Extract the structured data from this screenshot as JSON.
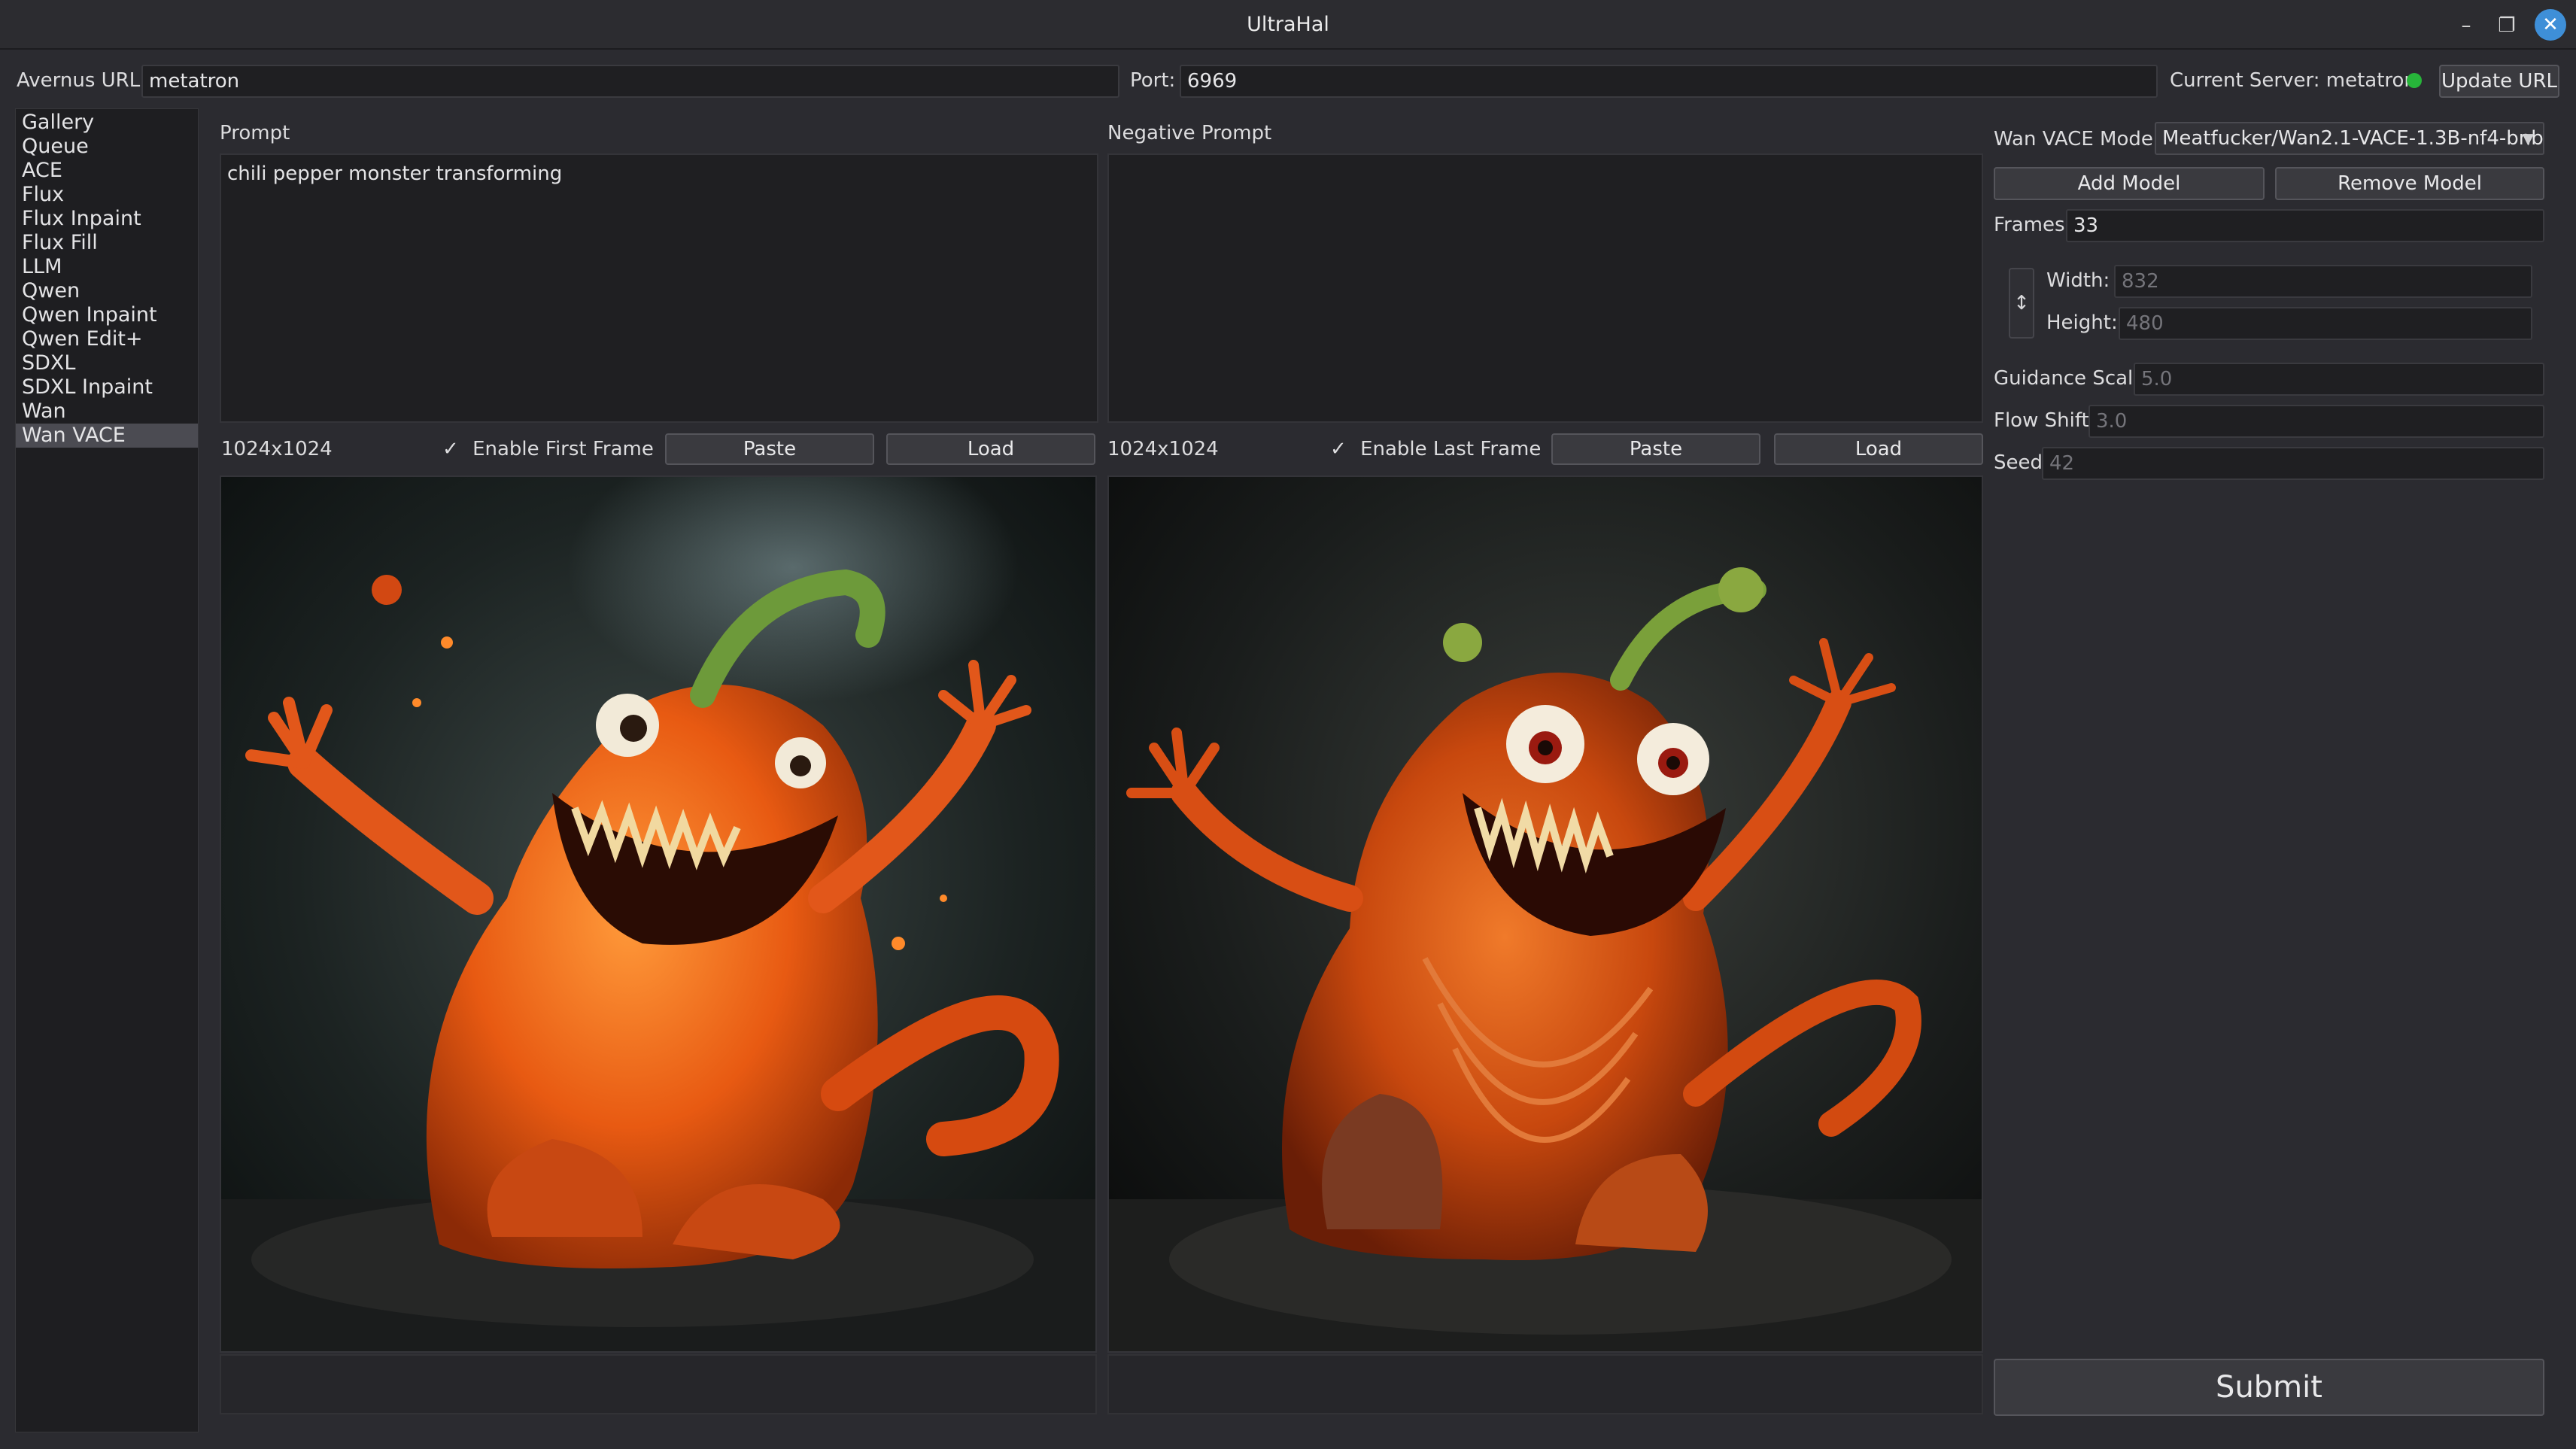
{
  "window": {
    "title": "UltraHal",
    "minimize": "–",
    "restore": "❐",
    "close": "✕"
  },
  "urlbar": {
    "avernus_label": "Avernus URL:",
    "avernus_value": "metatron",
    "port_label": "Port:",
    "port_value": "6969",
    "current_server": "Current Server: metatron",
    "status_color": "#27b53a",
    "update_button": "Update URL"
  },
  "sidebar": {
    "items": [
      "Gallery",
      "Queue",
      "ACE",
      "Flux",
      "Flux Inpaint",
      "Flux Fill",
      "LLM",
      "Qwen",
      "Qwen Inpaint",
      "Qwen Edit+",
      "SDXL",
      "SDXL Inpaint",
      "Wan",
      "Wan VACE"
    ],
    "selected": "Wan VACE"
  },
  "prompt": {
    "label": "Prompt",
    "value": "chili pepper monster transforming"
  },
  "negative_prompt": {
    "label": "Negative Prompt",
    "value": ""
  },
  "first_frame": {
    "size": "1024x1024",
    "checkmark": "✓",
    "checkbox_label": "Enable First Frame",
    "paste": "Paste",
    "load": "Load"
  },
  "last_frame": {
    "size": "1024x1024",
    "checkmark": "✓",
    "checkbox_label": "Enable Last Frame",
    "paste": "Paste",
    "load": "Load"
  },
  "settings": {
    "model_label": "Wan VACE Model",
    "model_value": "Meatfucker/Wan2.1-VACE-1.3B-nf4-bnb",
    "add_model": "Add Model",
    "remove_model": "Remove Model",
    "frames_label": "Frames",
    "frames_value": "33",
    "swap_icon": "↕",
    "width_label": "Width:",
    "width_placeholder": "832",
    "height_label": "Height:",
    "height_placeholder": "480",
    "guidance_label": "Guidance Scale",
    "guidance_placeholder": "5.0",
    "flow_label": "Flow Shift",
    "flow_placeholder": "3.0",
    "seed_label": "Seed",
    "seed_placeholder": "42",
    "submit": "Submit"
  }
}
